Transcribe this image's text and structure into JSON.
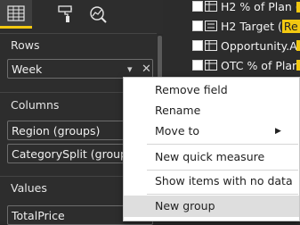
{
  "tabs": [
    {
      "name": "fields-tab-icon",
      "active": true
    },
    {
      "name": "format-tab-icon",
      "active": false
    },
    {
      "name": "analytics-tab-icon",
      "active": false
    }
  ],
  "sections": {
    "rows_label": "Rows",
    "columns_label": "Columns",
    "values_label": "Values"
  },
  "wells": {
    "rows": [
      "Week"
    ],
    "columns": [
      "Region (groups)",
      "CategorySplit (groups)"
    ],
    "values": [
      "TotalPrice"
    ]
  },
  "field_list": [
    {
      "label": "H2 % of Plan (",
      "highlight": "",
      "icon": "table-icon"
    },
    {
      "label": "H2 Target (",
      "highlight": "Re",
      "icon": "calc-icon"
    },
    {
      "label": "Opportunity.A",
      "highlight": "",
      "icon": "table-icon"
    },
    {
      "label": "OTC % of Plan",
      "highlight": "",
      "icon": "table-icon"
    }
  ],
  "context_menu": {
    "items": [
      {
        "label": "Remove field",
        "submenu": false
      },
      {
        "label": "Rename",
        "submenu": false
      },
      {
        "label": "Move to",
        "submenu": true
      },
      {
        "label": "New quick measure",
        "submenu": false
      },
      {
        "label": "Show items with no data",
        "submenu": false
      },
      {
        "label": "New group",
        "submenu": false
      }
    ],
    "hovered_item": "New group"
  },
  "colors": {
    "accent": "#f2c811",
    "pane_bg": "#2d2d2d",
    "menu_bg": "#ffffff",
    "menu_hover": "#dedede"
  }
}
